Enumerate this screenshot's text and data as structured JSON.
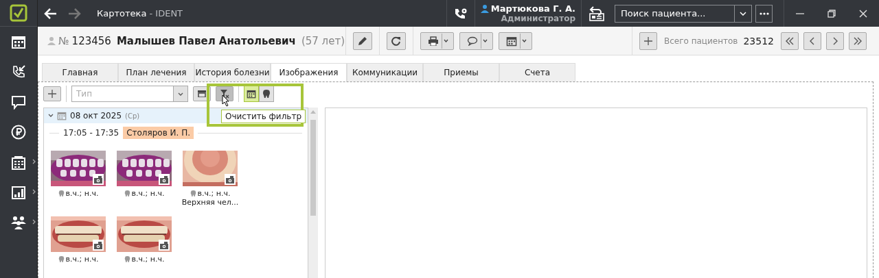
{
  "window": {
    "title": "Картотека",
    "app": " - IDENT",
    "forward_disabled": true
  },
  "user": {
    "name": "Мартюкова Г. А.",
    "role": "Администратор"
  },
  "search": {
    "placeholder": "Поиск пациента..."
  },
  "patient": {
    "number_sign": "№",
    "number": "123456",
    "name": "Малышев Павел Анатольевич",
    "age": "(57 лет)"
  },
  "patients_total": {
    "label": "Всего пациентов",
    "value": "23512"
  },
  "sidebar": {
    "items": [
      {
        "kind": "calendar",
        "submenu": false
      },
      {
        "kind": "call",
        "submenu": false
      },
      {
        "kind": "chat",
        "submenu": false
      },
      {
        "kind": "ruble",
        "submenu": false
      },
      {
        "kind": "schedule",
        "submenu": true
      },
      {
        "kind": "chart",
        "submenu": true
      },
      {
        "kind": "people",
        "submenu": true
      }
    ]
  },
  "tabs": [
    {
      "label": "Главная",
      "selected": false
    },
    {
      "label": "План лечения",
      "selected": false
    },
    {
      "label": "История болезни",
      "selected": false
    },
    {
      "label": "Изображения",
      "selected": true
    },
    {
      "label": "Коммуникации",
      "selected": false
    },
    {
      "label": "Приемы",
      "selected": false
    },
    {
      "label": "Счета",
      "selected": false
    }
  ],
  "images_toolbar": {
    "type_placeholder": "Тип",
    "clear_filter_pressed": true,
    "views": [
      {
        "kind": "calendar",
        "selected": true
      },
      {
        "kind": "tooth",
        "selected": false
      }
    ],
    "tooltip": "Очистить фильтр"
  },
  "groups": [
    {
      "date": "08 окт 2025",
      "weekday": "(Ср)",
      "expanded": true,
      "appointments": [
        {
          "time": "17:05 - 17:35",
          "doctor": "Столяров И. П.",
          "color": "#fbcba6",
          "images": [
            {
              "kind": "picture",
              "caption": "в.ч.; н.ч."
            },
            {
              "kind": "picture",
              "caption": "в.ч.; н.ч."
            },
            {
              "kind": "picture",
              "caption": "в.ч.; н.ч.",
              "note": "Верхняя чел..."
            },
            {
              "kind": "picture",
              "caption": "в.ч.; н.ч."
            },
            {
              "kind": "picture",
              "caption": "в.ч.; н.ч."
            }
          ]
        }
      ]
    }
  ]
}
